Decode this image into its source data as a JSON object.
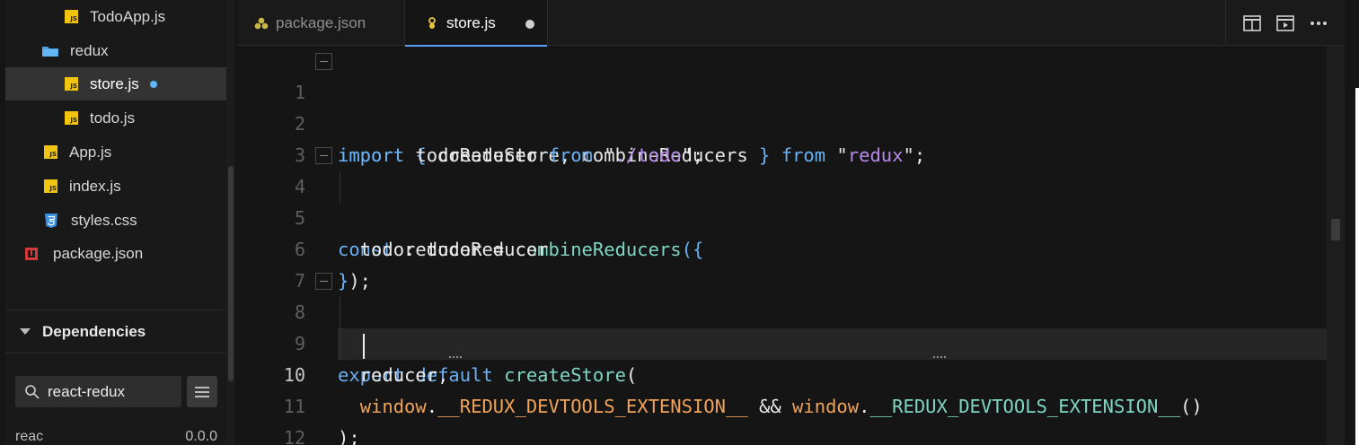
{
  "sidebar": {
    "files": [
      {
        "label": "TodoApp.js",
        "type": "js"
      },
      {
        "label": "redux",
        "type": "folder"
      },
      {
        "label": "store.js",
        "type": "js",
        "active": true,
        "modified": true
      },
      {
        "label": "todo.js",
        "type": "js"
      },
      {
        "label": "App.js",
        "type": "js"
      },
      {
        "label": "index.js",
        "type": "js"
      },
      {
        "label": "styles.css",
        "type": "css"
      },
      {
        "label": "package.json",
        "type": "package"
      }
    ],
    "dependencies_title": "Dependencies",
    "search_value": "react-redux",
    "dependency_row": {
      "name": "reac",
      "version": "0.0.0"
    }
  },
  "tabs": [
    {
      "label": "package.json",
      "active": false
    },
    {
      "label": "store.js",
      "active": true,
      "unsaved": true
    }
  ],
  "editor": {
    "current_line": 10,
    "lines": [
      {
        "n": "1",
        "text": "import { createStore, combineReducers } from \"redux\";"
      },
      {
        "n": "2",
        "text": "import todoReducer from \"./todo\";"
      },
      {
        "n": "3",
        "text": ""
      },
      {
        "n": "4",
        "text": "const reducer = combineReducers({"
      },
      {
        "n": "5",
        "text": "  todo: todoReducer"
      },
      {
        "n": "6",
        "text": "});"
      },
      {
        "n": "7",
        "text": ""
      },
      {
        "n": "8",
        "text": "export default createStore("
      },
      {
        "n": "9",
        "text": "  reducer,"
      },
      {
        "n": "10",
        "text": "  window.__REDUX_DEVTOOLS_EXTENSION__ && window.__REDUX_DEVTOOLS_EXTENSION__()"
      },
      {
        "n": "11",
        "text": ");"
      },
      {
        "n": "12",
        "text": ""
      }
    ]
  },
  "icons": {
    "split": "split-editor-icon",
    "preview": "open-preview-icon",
    "more": "more-actions-icon",
    "search": "search-icon",
    "menu": "menu-icon"
  },
  "colors": {
    "keyword": "#6ab0f3",
    "string": "#b88ae8",
    "function": "#7fd6c2",
    "global": "#f0a35a",
    "accent": "#5a9df8",
    "js_badge": "#f1c40f"
  }
}
